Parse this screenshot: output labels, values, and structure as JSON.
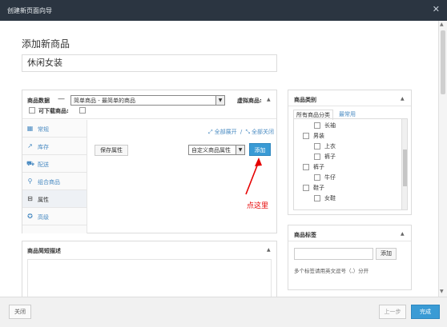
{
  "titlebar": {
    "title": "创建新页面向导",
    "close_label": "✕"
  },
  "page": {
    "heading": "添加新商品",
    "title_value": "休闲女装"
  },
  "product_data": {
    "label": "商品数据",
    "dash": "—",
    "type_selected": "简单商品 - 最简单的商品",
    "virtual_label": "虚拟商品:",
    "downloadable_label": "可下载商品:",
    "tabs": [
      {
        "label": "常规",
        "icon": "grid-icon"
      },
      {
        "label": "库存",
        "icon": "chart-icon"
      },
      {
        "label": "配送",
        "icon": "truck-icon"
      },
      {
        "label": "组合商品",
        "icon": "link-icon"
      },
      {
        "label": "属性",
        "icon": "list-icon"
      },
      {
        "label": "高级",
        "icon": "gear-icon"
      }
    ],
    "expand_all": "全部展开",
    "close_all": "全部关闭",
    "slash": "/",
    "save_attr": "保存属性",
    "attr_select": "自定义商品属性",
    "add_label": "添加"
  },
  "annotation": {
    "text": "点这里",
    "color": "#e60000"
  },
  "short_desc": {
    "label": "商品简短描述"
  },
  "categories": {
    "label": "商品类别",
    "tab_all": "所有商品分类",
    "tab_common": "最常用",
    "items": [
      "长袖",
      "男装",
      "上衣",
      "裤子",
      "裤子",
      "牛仔",
      "鞋子",
      "女鞋"
    ]
  },
  "tags": {
    "label": "商品标签",
    "add_label": "添加",
    "hint": "多个标签请用英文逗号（,）分开"
  },
  "footer": {
    "close_label": "关闭",
    "prev_label": "上一步",
    "done_label": "完成"
  },
  "colors": {
    "accent": "#3a9bd5",
    "titlebar": "#2b3541",
    "link": "#4a8bc2"
  }
}
